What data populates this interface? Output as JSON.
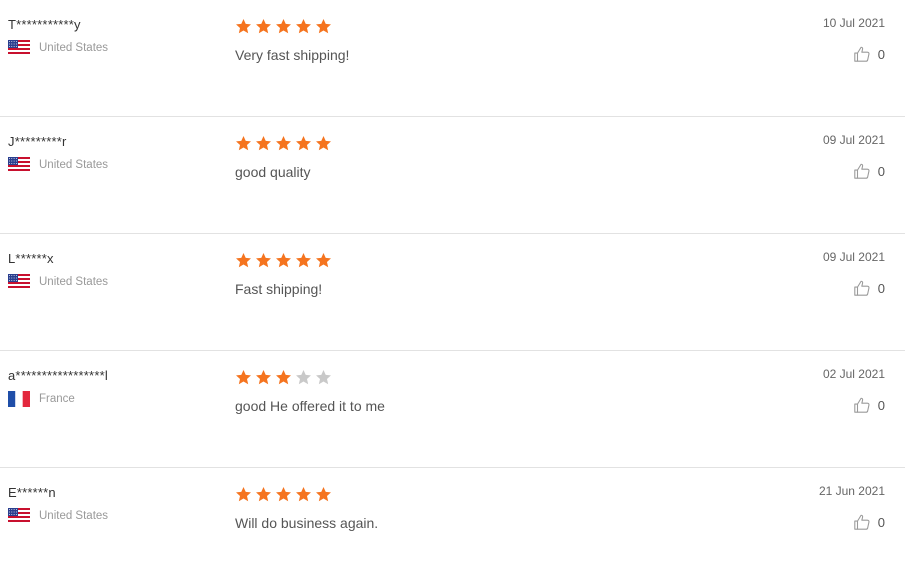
{
  "colors": {
    "star_filled": "#f5741f",
    "star_empty": "#c9c9c9",
    "divider": "#e2e2e2"
  },
  "reviews": [
    {
      "user": "T***********y",
      "country": "United States",
      "flag": "us",
      "rating": 5,
      "text": "Very fast shipping!",
      "date": "10 Jul 2021",
      "likes": "0"
    },
    {
      "user": "J*********r",
      "country": "United States",
      "flag": "us",
      "rating": 5,
      "text": "good quality",
      "date": "09 Jul 2021",
      "likes": "0"
    },
    {
      "user": "L******x",
      "country": "United States",
      "flag": "us",
      "rating": 5,
      "text": "Fast shipping!",
      "date": "09 Jul 2021",
      "likes": "0"
    },
    {
      "user": "a*****************l",
      "country": "France",
      "flag": "fr",
      "rating": 3,
      "text": "good He offered it to me",
      "date": "02 Jul 2021",
      "likes": "0"
    },
    {
      "user": "E******n",
      "country": "United States",
      "flag": "us",
      "rating": 5,
      "text": "Will do business again.",
      "date": "21 Jun 2021",
      "likes": "0"
    }
  ]
}
